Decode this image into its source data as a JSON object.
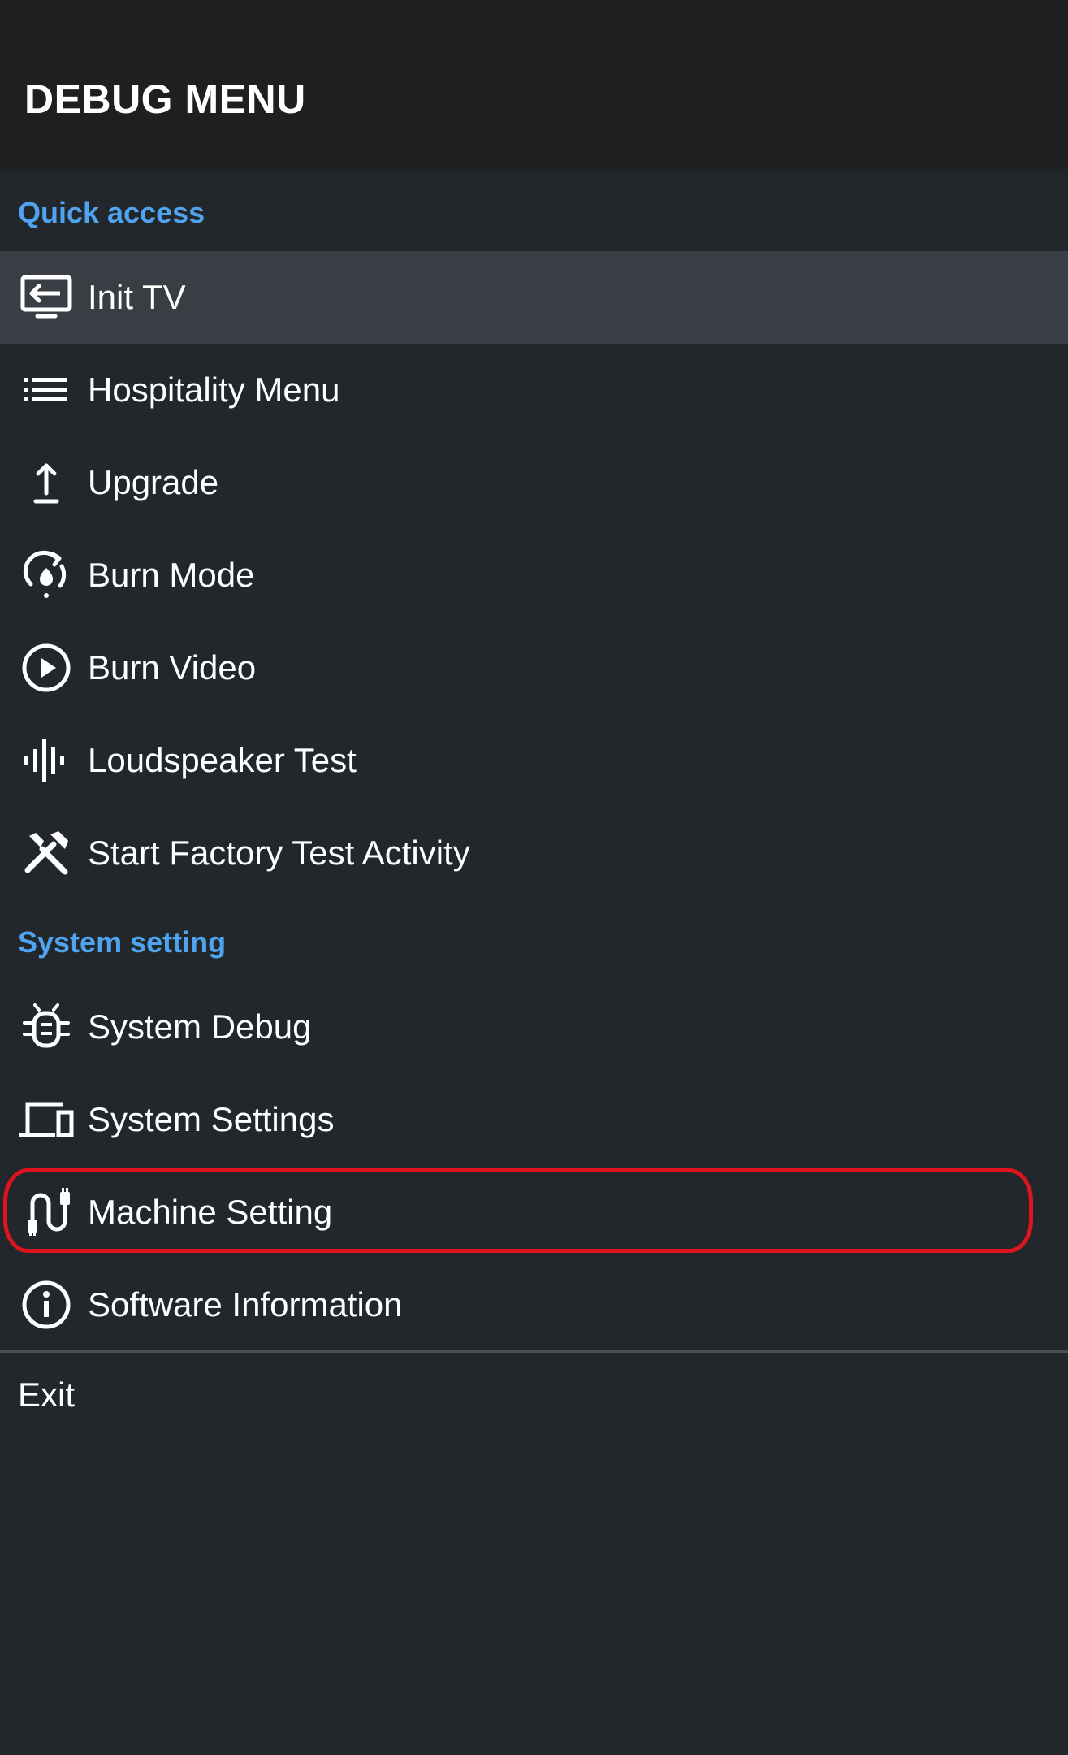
{
  "header": {
    "title": "DEBUG MENU"
  },
  "sections": {
    "quick_access": "Quick access",
    "system_setting": "System setting"
  },
  "quick_items": [
    {
      "label": "Init TV",
      "icon": "input-tv-icon",
      "selected": true
    },
    {
      "label": "Hospitality Menu",
      "icon": "list-icon"
    },
    {
      "label": "Upgrade",
      "icon": "upload-arrow-icon"
    },
    {
      "label": "Burn Mode",
      "icon": "burn-cycle-icon"
    },
    {
      "label": "Burn Video",
      "icon": "play-circle-icon"
    },
    {
      "label": "Loudspeaker Test",
      "icon": "audio-waveform-icon"
    },
    {
      "label": "Start Factory Test Activity",
      "icon": "tools-icon"
    }
  ],
  "system_items": [
    {
      "label": "System Debug",
      "icon": "bug-icon"
    },
    {
      "label": "System Settings",
      "icon": "devices-icon"
    },
    {
      "label": "Machine Setting",
      "icon": "cable-icon",
      "annotated": true
    },
    {
      "label": "Software Information",
      "icon": "info-circle-icon"
    }
  ],
  "footer": {
    "exit_label": "Exit"
  },
  "colors": {
    "header_bg": "#201f20",
    "page_bg": "#22272c",
    "selected_bg": "#383e43",
    "section_accent": "#4fa3ef",
    "annotation_red": "#e0141e"
  }
}
